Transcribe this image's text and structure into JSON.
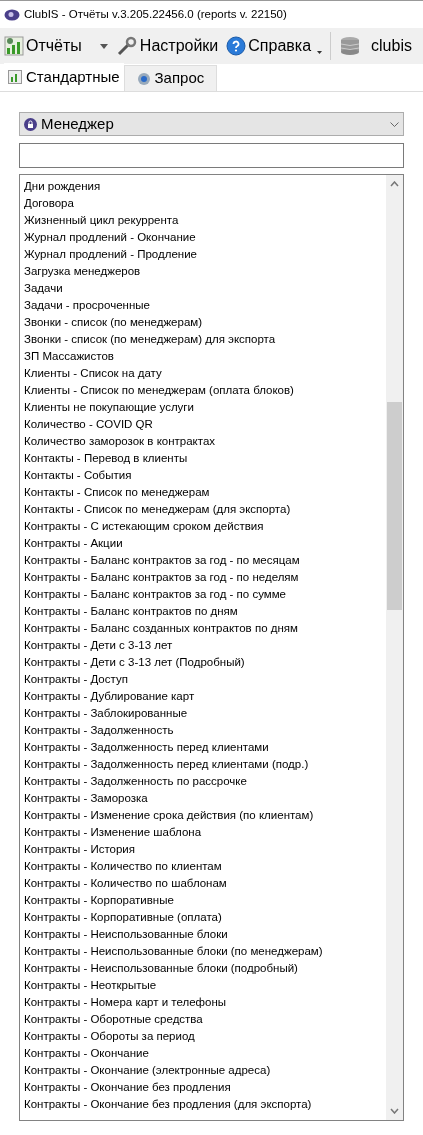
{
  "window": {
    "title": "ClubIS - Отчёты v.3.205.22456.0 (reports v. 22150)"
  },
  "toolbar": [
    {
      "label": "Отчёты",
      "kind": "dropdown"
    },
    {
      "label": "Настройки",
      "kind": "button"
    },
    {
      "label": "Справка",
      "kind": "menu"
    },
    {
      "label": "clubis",
      "kind": "button"
    }
  ],
  "tabs": [
    {
      "label": "Стандартные",
      "selected": true
    },
    {
      "label": "Запрос",
      "selected": false
    }
  ],
  "category": {
    "value": "Менеджер"
  },
  "reports": [
    "Дни рождения",
    "Договора",
    "Жизненный цикл рекуррента",
    "Журнал продлений - Окончание",
    "Журнал продлений - Продление",
    "Загрузка менеджеров",
    "Задачи",
    "Задачи - просроченные",
    "Звонки - список (по менеджерам)",
    "Звонки - список (по менеджерам) для экспорта",
    "ЗП Массажистов",
    "Клиенты - Список на дату",
    "Клиенты - Список по менеджерам (оплата блоков)",
    "Клиенты не покупающие услуги",
    "Количество - COVID QR",
    "Количество заморозок в контрактах",
    "Контакты - Перевод в клиенты",
    "Контакты - События",
    "Контакты - Список по менеджерам",
    "Контакты - Список по менеджерам (для экспорта)",
    "Контракты - С истекающим сроком действия",
    "Контракты - Акции",
    "Контракты - Баланс контрактов за год - по месяцам",
    "Контракты - Баланс контрактов за год - по неделям",
    "Контракты - Баланс контрактов за год - по сумме",
    "Контракты - Баланс контрактов по дням",
    "Контракты - Баланс созданных контрактов по дням",
    "Контракты - Дети с 3-13 лет",
    "Контракты - Дети с 3-13 лет (Подробный)",
    "Контракты - Доступ",
    "Контракты - Дублирование карт",
    "Контракты - Заблокированные",
    "Контракты - Задолженность",
    "Контракты - Задолженность перед клиентами",
    "Контракты - Задолженность перед клиентами (подр.)",
    "Контракты - Задолженность по рассрочке",
    "Контракты - Заморозка",
    "Контракты - Изменение срока действия (по клиентам)",
    "Контракты - Изменение шаблона",
    "Контракты - История",
    "Контракты - Количество по клиентам",
    "Контракты - Количество по шаблонам",
    "Контракты - Корпоративные",
    "Контракты - Корпоративные (оплата)",
    "Контракты - Неиспользованные блоки",
    "Контракты - Неиспользованные блоки (по менеджерам)",
    "Контракты - Неиспользованные блоки (подробный)",
    "Контракты - Неоткрытые",
    "Контракты - Номера карт и телефоны",
    "Контракты - Оборотные средства",
    "Контракты - Обороты за период",
    "Контракты - Окончание",
    "Контракты - Окончание (электронные адреса)",
    "Контракты - Окончание без продления",
    "Контракты - Окончание без продления (для экспорта)"
  ]
}
